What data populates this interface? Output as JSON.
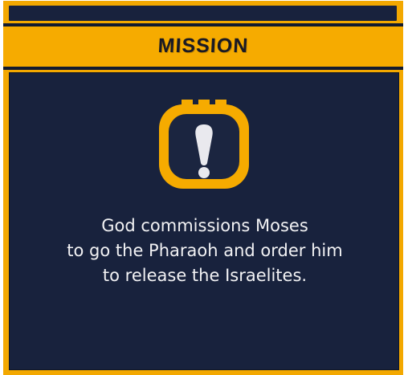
{
  "header": {
    "title": "MISSION"
  },
  "mission": {
    "icon": "mission-alert-icon",
    "lines": [
      "God commissions Moses",
      "to go the Pharaoh and order him",
      "to release the Israelites."
    ]
  },
  "colors": {
    "frame": "#f3a800",
    "panel": "#18223d",
    "text": "#f2f2f4",
    "title": "#1a1a24"
  }
}
